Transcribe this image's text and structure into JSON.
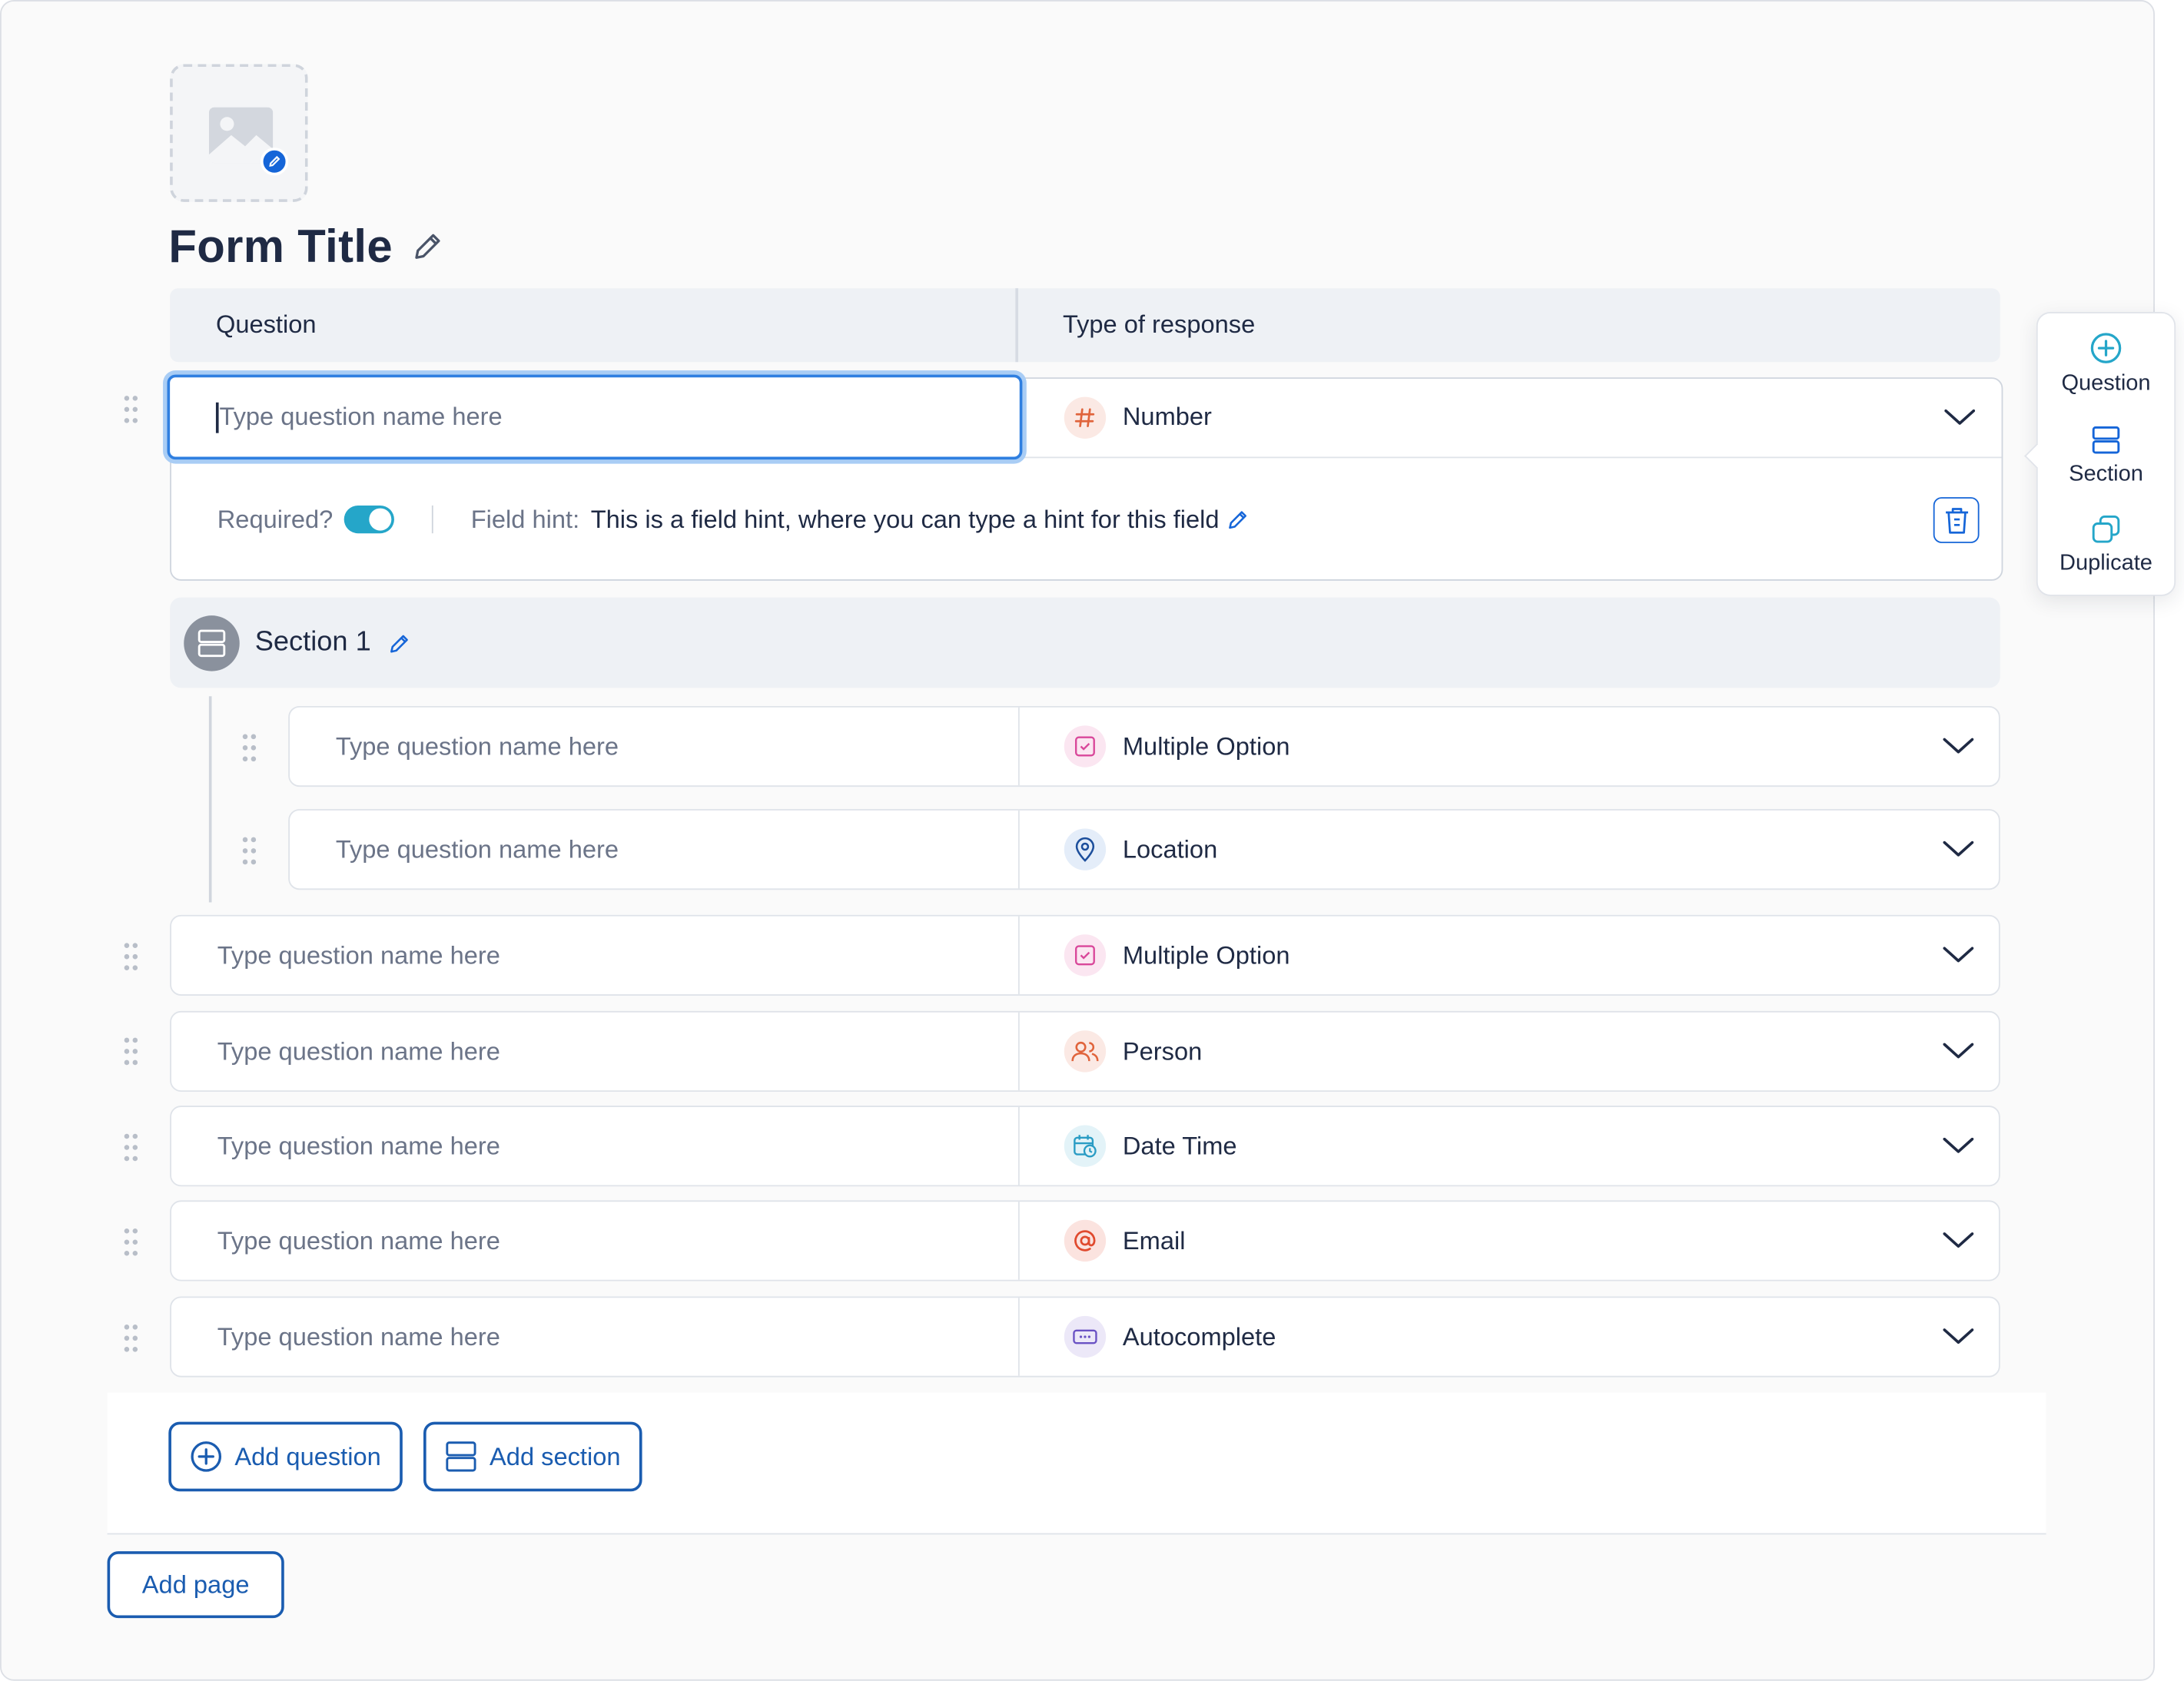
{
  "form": {
    "title": "Form Title"
  },
  "columns": {
    "question": "Question",
    "type": "Type of response"
  },
  "active_question": {
    "placeholder": "Type question name here",
    "type": "Number",
    "required_label": "Required?",
    "required": true,
    "field_hint_label": "Field hint:",
    "field_hint": "This is a field hint, where you can type a hint for this field"
  },
  "section": {
    "title": "Section 1",
    "questions": [
      {
        "placeholder": "Type question name here",
        "type": "Multiple Option",
        "icon": "checkbox-icon"
      },
      {
        "placeholder": "Type question name here",
        "type": "Location",
        "icon": "location-pin-icon"
      }
    ]
  },
  "questions": [
    {
      "placeholder": "Type question name here",
      "type": "Multiple Option",
      "icon": "checkbox-icon"
    },
    {
      "placeholder": "Type question name here",
      "type": "Person",
      "icon": "people-icon"
    },
    {
      "placeholder": "Type question name here",
      "type": "Date Time",
      "icon": "calendar-clock-icon"
    },
    {
      "placeholder": "Type question name here",
      "type": "Email",
      "icon": "at-sign-icon"
    },
    {
      "placeholder": "Type question name here",
      "type": "Autocomplete",
      "icon": "text-box-icon"
    }
  ],
  "toolbar": {
    "question": "Question",
    "section": "Section",
    "duplicate": "Duplicate"
  },
  "actions": {
    "add_question": "Add question",
    "add_section": "Add section",
    "add_page": "Add page"
  },
  "colors": {
    "accent": "#1565d8",
    "toggle": "#25a6c9",
    "focus": "#2f7fe0"
  }
}
